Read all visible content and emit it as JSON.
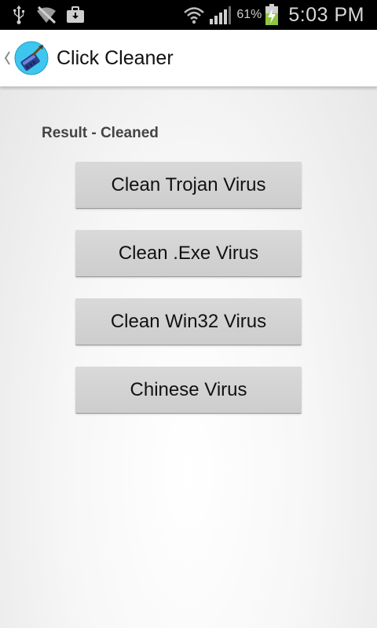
{
  "status_bar": {
    "battery_percent": "61%",
    "time": "5:03 PM",
    "left_icons": [
      "usb-icon",
      "no-signal-icon",
      "briefcase-icon"
    ],
    "right_icons": [
      "wifi-icon",
      "signal-icon",
      "battery-charging-icon"
    ]
  },
  "action_bar": {
    "title": "Click Cleaner",
    "icon": "app-broom-icon"
  },
  "main": {
    "result_label": "Result - Cleaned",
    "buttons": [
      {
        "label": "Clean Trojan Virus"
      },
      {
        "label": "Clean .Exe Virus"
      },
      {
        "label": "Clean Win32 Virus"
      },
      {
        "label": "Chinese Virus"
      }
    ]
  },
  "colors": {
    "status_bar_bg": "#000000",
    "action_bar_bg": "#ffffff",
    "button_bg": "#d4d4d4",
    "battery_green": "#8ec63f",
    "app_icon_bg": "#3fc6ee"
  }
}
